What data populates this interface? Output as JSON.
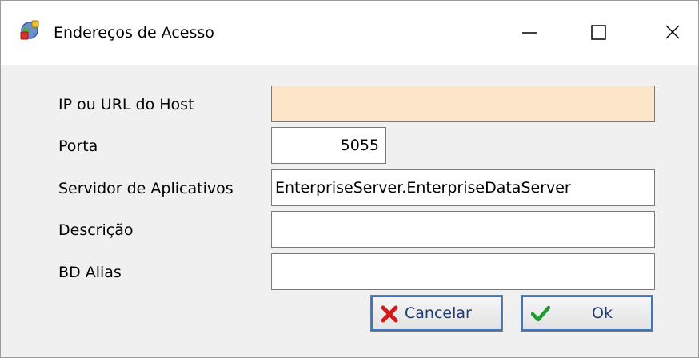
{
  "window": {
    "title": "Endereços de Acesso",
    "icon": "app-globe-icon",
    "controls": [
      "minimize-icon",
      "maximize-icon",
      "close-icon"
    ]
  },
  "form": {
    "host": {
      "label": "IP ou URL do Host",
      "value": ""
    },
    "port": {
      "label": "Porta",
      "value": "5055"
    },
    "server": {
      "label": "Servidor de Aplicativos",
      "value": "EnterpriseServer.EnterpriseDataServer"
    },
    "description": {
      "label": "Descrição",
      "value": ""
    },
    "alias": {
      "label": "BD Alias",
      "value": ""
    }
  },
  "buttons": {
    "cancel": {
      "label": "Cancelar",
      "icon": "x-icon"
    },
    "ok": {
      "label": "Ok",
      "icon": "check-icon"
    }
  },
  "colors": {
    "host_field_bg": "#fde5ca",
    "button_text": "#1f3a6d",
    "cancel_icon": "#d7191c",
    "ok_icon": "#1e9e2e"
  }
}
